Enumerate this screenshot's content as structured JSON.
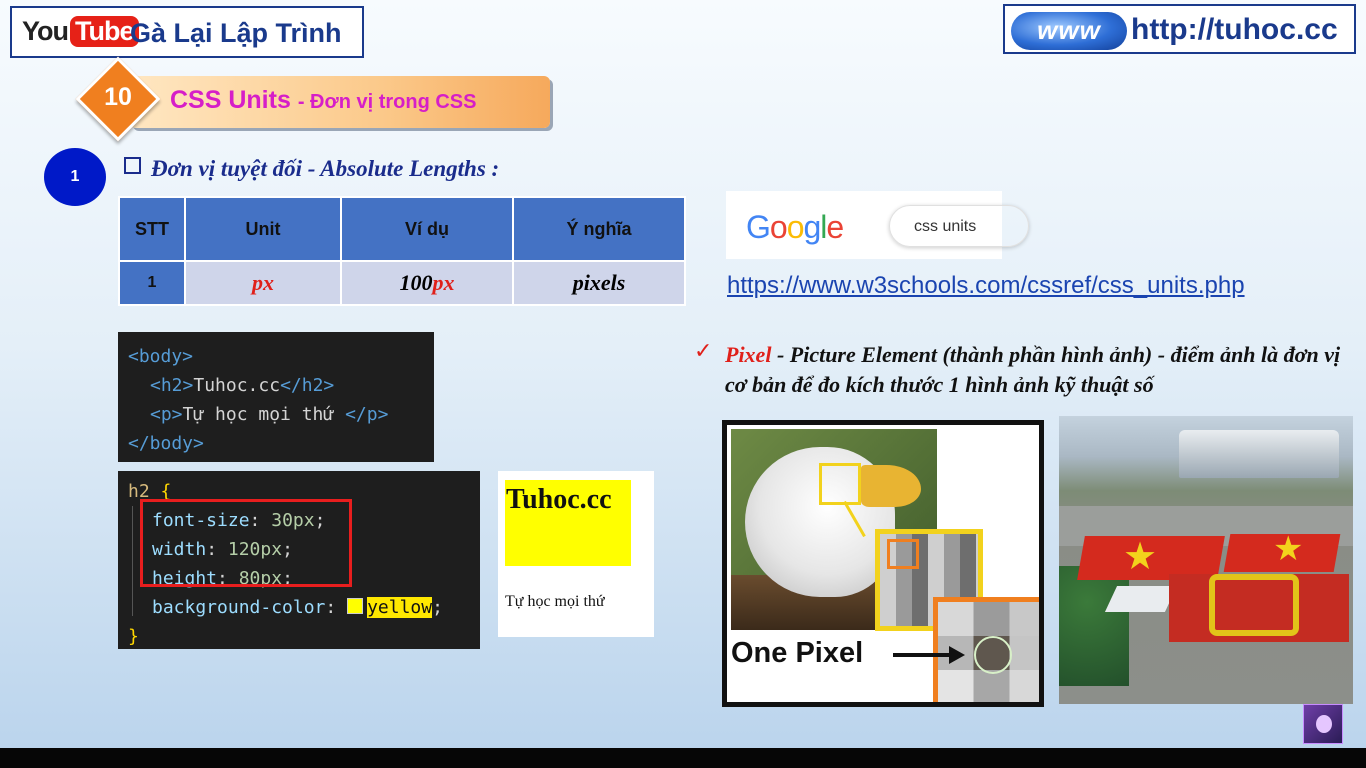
{
  "header": {
    "youtube_you": "You",
    "youtube_tube": "Tube",
    "channel_name": "Gà Lại Lập Trình",
    "www_text": "www",
    "site_url": "http://tuhoc.cc"
  },
  "lesson": {
    "number": "10",
    "title": "CSS Units",
    "subtitle": "- Đơn vị trong CSS"
  },
  "section": {
    "number": "1",
    "title": "Đơn vị tuyệt đối - Absolute Lengths :"
  },
  "units_table": {
    "headers": [
      "STT",
      "Unit",
      "Ví dụ",
      "Ý nghĩa"
    ],
    "rows": [
      {
        "stt": "1",
        "unit": "px",
        "example_num": "100",
        "example_unit": "px",
        "meaning": "pixels"
      }
    ]
  },
  "google": {
    "logo": "Google",
    "query": "css units",
    "link": "https://www.w3schools.com/cssref/css_units.php",
    "logo_colors": [
      "#4285f4",
      "#ea4335",
      "#fbbc05",
      "#4285f4",
      "#34a853",
      "#ea4335"
    ]
  },
  "code_html": {
    "lines": [
      "<body>",
      "<h2>",
      "Tuhoc.cc",
      "</h2>",
      "<p>",
      "Tự học mọi thứ ",
      "</p>",
      "</body>"
    ]
  },
  "code_css": {
    "selector": "h2",
    "open_brace": "{",
    "close_brace": "}",
    "props": [
      {
        "name": "font-size",
        "value": "30px"
      },
      {
        "name": "width",
        "value": "120px"
      },
      {
        "name": "height",
        "value": "80px"
      },
      {
        "name": "background-color",
        "value": "yellow"
      }
    ]
  },
  "preview": {
    "h2": "Tuhoc.cc",
    "p": "Tự học mọi thứ"
  },
  "pixel_note": {
    "term": "Pixel",
    "text": " - Picture Element (thành phần hình ảnh) - điểm ảnh là đơn vị cơ bản để đo kích thước 1 hình ảnh kỹ thuật số"
  },
  "eagle_figure": {
    "label": "One Pixel"
  },
  "colors": {
    "title_magenta": "#d61ec8",
    "accent_orange": "#f07f1f",
    "table_blue": "#4472c4",
    "unit_red": "#e0201a",
    "link_blue": "#1a44b0"
  }
}
